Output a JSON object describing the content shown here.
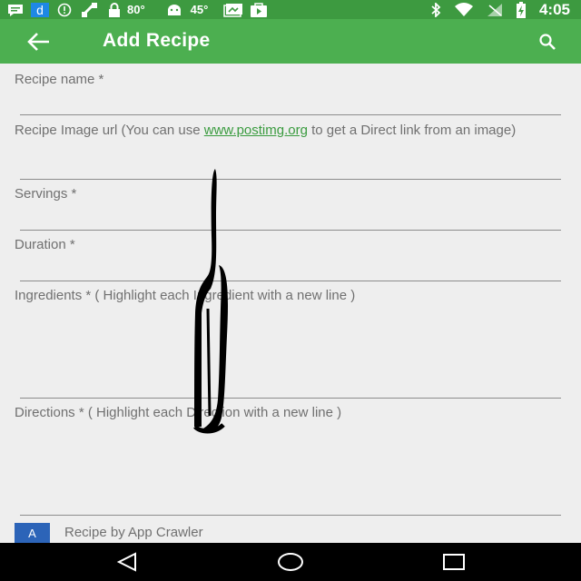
{
  "status_bar": {
    "icons_left": [
      "message-icon",
      "d-app-icon",
      "info-icon",
      "satellite-icon",
      "lock-icon",
      "android-icon",
      "photo-icon",
      "play-store-icon"
    ],
    "temp1": "80°",
    "temp2": "45°",
    "icons_right": [
      "bluetooth-icon",
      "wifi-icon",
      "signal-icon",
      "battery-icon"
    ],
    "time": "4:05"
  },
  "toolbar": {
    "title": "Add Recipe",
    "back_icon": "arrow-left-icon",
    "search_icon": "search-icon"
  },
  "form": {
    "recipe_name_label": "Recipe name *",
    "image_url_label_pre": "Recipe Image url (You can use ",
    "image_url_link": "www.postimg.org",
    "image_url_label_post": " to get a Direct link from an image)",
    "servings_label": "Servings *",
    "duration_label": "Duration *",
    "ingredients_label": "Ingredients * ( Highlight each Ingredient with a new line )",
    "directions_label": "Directions * ( Highlight each Direction with a new line )"
  },
  "banner": {
    "badge": "A",
    "text": "Recipe by App Crawler"
  },
  "nav": {
    "back": "back-triangle-icon",
    "home": "home-circle-icon",
    "recents": "recents-square-icon"
  },
  "colors": {
    "status_bar": "#3d9a40",
    "toolbar": "#4caf50",
    "background": "#eeeeee",
    "link": "#3a9b3f",
    "badge": "#2c64b8"
  }
}
